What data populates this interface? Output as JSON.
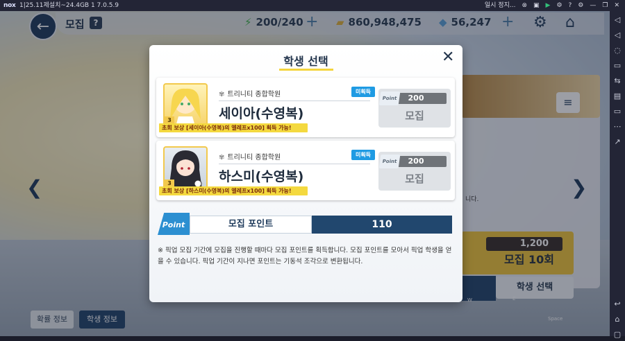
{
  "titlebar": {
    "logo": "nox",
    "title": "1|25.11제설치~24.4GB  1  7.0.5.9",
    "pause_label": "일시 정지..."
  },
  "hud": {
    "title": "모집",
    "help": "?",
    "stamina": "200/240",
    "credits": "860,948,475",
    "gems": "56,247"
  },
  "background": {
    "cost": "1,200",
    "recruit10": "모집 10회",
    "student_select": "학생 선택",
    "tab_rates": "확률 정보",
    "tab_students": "학생 정보",
    "partial_text": "니다.",
    "key_w": "W",
    "key_e": "E",
    "key_space": "Space"
  },
  "modal": {
    "title": "학생 선택",
    "students": [
      {
        "school": "트리니티 종합학원",
        "badge": "미획득",
        "name": "세이아(수영복)",
        "reward": "초회 보상 [세이아(수영복)의 엘레프x100] 획득 가능!",
        "point_tag": "Point",
        "cost": "200",
        "button": "모집",
        "star": "3"
      },
      {
        "school": "트리니티 종합학원",
        "badge": "미획득",
        "name": "하스미(수영복)",
        "reward": "초회 보상 [하스미(수영복)의 엘레프x100] 획득 가능!",
        "point_tag": "Point",
        "cost": "200",
        "button": "모집",
        "star": "3"
      }
    ],
    "point_badge": "Point",
    "point_label": "모집 포인트",
    "point_value": "110",
    "note": "※ 픽업 모집 기간에 모집을 진행할 때마다 모집 포인트를 획득합니다. 모집 포인트를 모아서 픽업 학생을 얻을 수 있습니다. 픽업 기간이 지나면 포인트는 기동석 조각으로 변환됩니다."
  }
}
